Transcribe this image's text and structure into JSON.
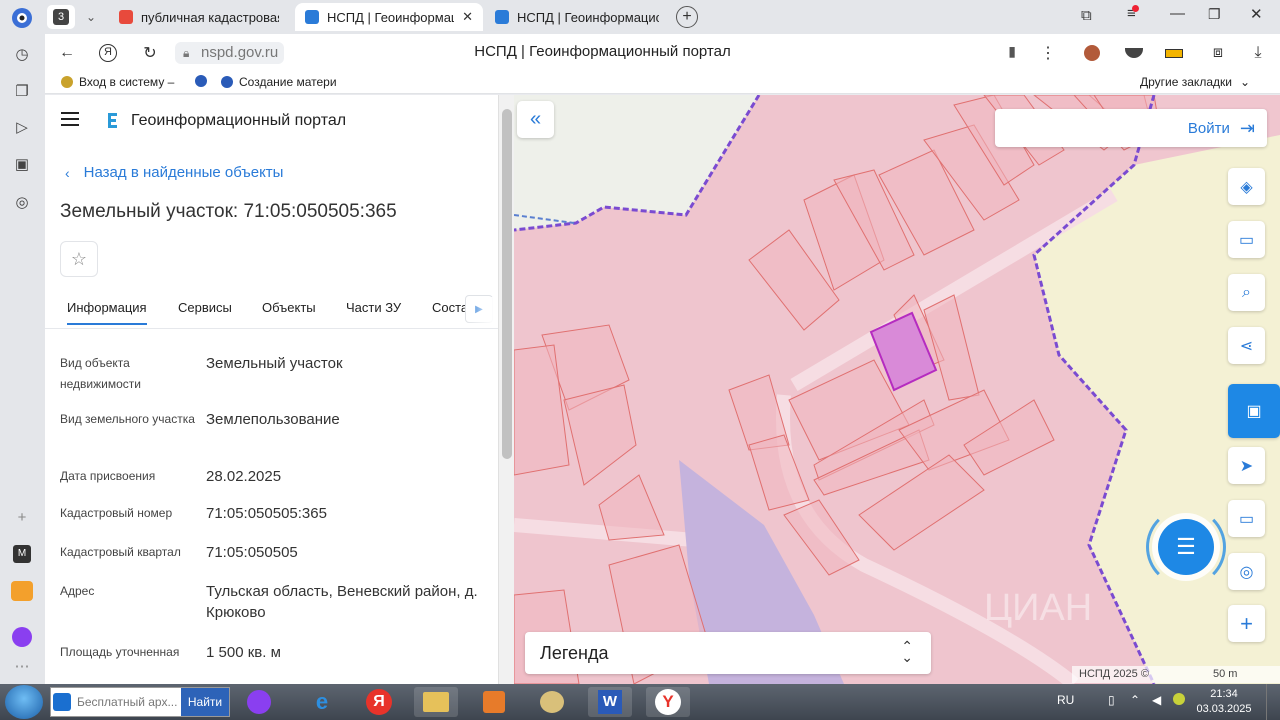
{
  "browser": {
    "tabs": [
      {
        "label": "публичная кадастровая к",
        "color": "#e84a3c",
        "active": false
      },
      {
        "label": "НСПД | Геоинформацион",
        "color": "#2a7bd8",
        "active": true
      },
      {
        "label": "НСПД | Геоинформацион",
        "color": "#2a7bd8",
        "active": false
      }
    ],
    "tab_count_badge": "3",
    "domain": "nspd.gov.ru",
    "page_title": "НСПД | Геоинформационный портал",
    "bookmarks": [
      "Вход в систему –",
      "Создание матери"
    ],
    "other_bookmarks": "Другие закладки"
  },
  "portal": {
    "name": "Геоинформационный портал",
    "back_link": "Назад в найденные объекты",
    "object_title": "Земельный участок: 71:05:050505:365",
    "tabs": [
      "Информация",
      "Сервисы",
      "Объекты",
      "Части ЗУ",
      "Соста"
    ],
    "fields": [
      {
        "label": "Вид объекта недвижимости",
        "value": "Земельный участок"
      },
      {
        "label": "Вид земельного участка",
        "value": "Землепользование"
      },
      {
        "label": "Дата присвоения",
        "value": "28.02.2025"
      },
      {
        "label": "Кадастровый номер",
        "value": "71:05:050505:365"
      },
      {
        "label": "Кадастровый квартал",
        "value": "71:05:050505"
      },
      {
        "label": "Адрес",
        "value": "Тульская область, Веневский район, д. Крюково"
      },
      {
        "label": "Площадь уточненная",
        "value": "1 500 кв. м"
      }
    ]
  },
  "map": {
    "login": "Войти",
    "legend": "Легенда",
    "copyright": "НСПД 2025 ©",
    "scale": "50 m",
    "colors": {
      "parcel_fill": "#f2c6cf",
      "parcel_stroke": "#e87d7d",
      "selected": "#c26bd0",
      "boundary": "#7a4bd1",
      "water": "#c5b3dd",
      "outside": "#f4f1d4"
    }
  },
  "taskbar": {
    "search_placeholder": "Бесплатный арх...",
    "search_button": "Найти",
    "lang": "RU",
    "time": "21:34",
    "date": "03.03.2025"
  }
}
